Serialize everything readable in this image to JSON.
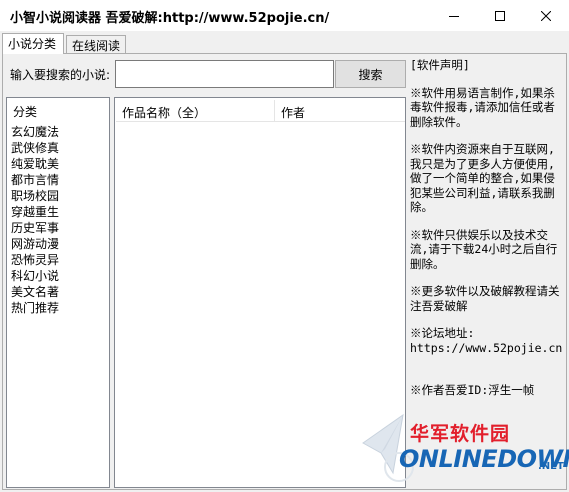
{
  "window": {
    "title": "小智小说阅读器  吾爱破解:http://www.52pojie.cn/"
  },
  "tabs": [
    {
      "label": "小说分类",
      "active": true
    },
    {
      "label": "在线阅读",
      "active": false
    }
  ],
  "search": {
    "label": "输入要搜索的小说:",
    "value": "",
    "button_label": "搜索"
  },
  "category_list": {
    "header": "分类",
    "items": [
      "玄幻魔法",
      "武侠修真",
      "纯爱耽美",
      "都市言情",
      "职场校园",
      "穿越重生",
      "历史军事",
      "网游动漫",
      "恐怖灵异",
      "科幻小说",
      "美文名著",
      "热门推荐"
    ]
  },
  "result_list": {
    "columns": [
      "作品名称（全）",
      "作者"
    ]
  },
  "notice": {
    "title": "[软件声明]",
    "paragraphs": [
      "※软件用易语言制作,如果杀毒软件报毒,请添加信任或者删除软件。",
      "※软件内资源来自于互联网,我只是为了更多人方便使用,做了一个简单的整合,如果侵犯某些公司利益,请联系我删除。",
      "※软件只供娱乐以及技术交流,请于下载24小时之后自行删除。",
      "※更多软件以及破解教程请关注吾爱破解"
    ],
    "forum_label": "※论坛地址:",
    "forum_url": "https://www.52pojie.cn",
    "author_line": "※作者吾爱ID:浮生一帧"
  },
  "watermark": {
    "cn": "华军软件园",
    "en": "ONLINEDOWN",
    "com": ".NET"
  },
  "icons": {
    "minimize": "minimize-icon",
    "maximize": "maximize-icon",
    "close": "close-icon",
    "watermark_logo": "onlinedown-logo-icon"
  },
  "colors": {
    "window_bg": "#f0f0f0",
    "list_border": "#828790",
    "watermark_red": "#e21f2c",
    "watermark_blue": "#1766b5"
  }
}
